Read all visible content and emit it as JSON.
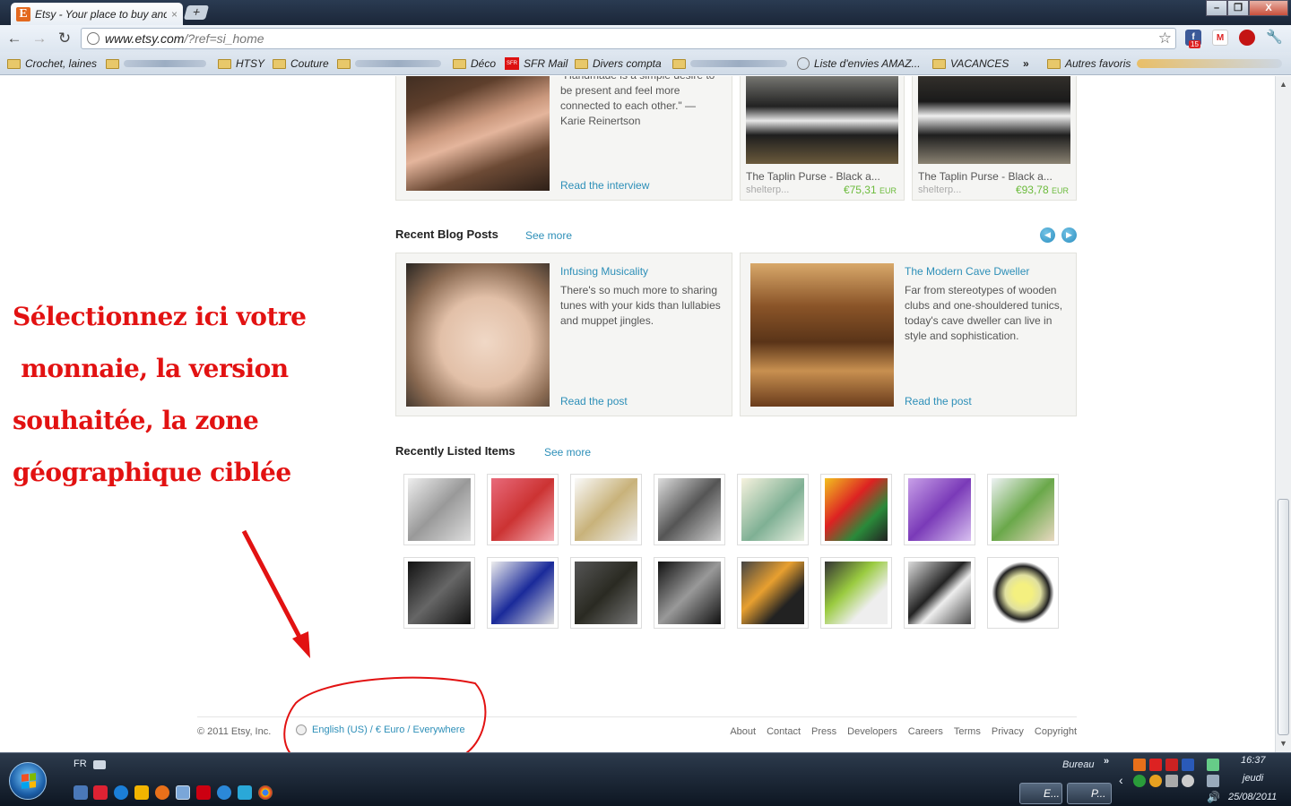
{
  "browser": {
    "tab_title": "Etsy - Your place to buy and",
    "tab_close": "×",
    "new_tab": "+",
    "url_host": "www.etsy.com",
    "url_rest": "/?ref=si_home",
    "ext_badge": "15",
    "bookmarks": [
      "Crochet, laines",
      "HTSY",
      "Couture",
      "Déco",
      "SFR Mail",
      "Divers compta",
      "Liste d'envies AMAZ...",
      "VACANCES",
      "Autres favoris"
    ],
    "bookmarks_more": "»",
    "window_controls": {
      "minimize": "–",
      "maximize": "❐",
      "close": "X"
    }
  },
  "featured": {
    "quote": "\"Handmade is a simple desire to be present and feel more connected to each other.\" — Karie Reinertson",
    "read_link": "Read the interview",
    "products": [
      {
        "title": "The Taplin Purse - Black a...",
        "shop": "shelterp...",
        "price": "€75,31",
        "currency": "EUR"
      },
      {
        "title": "The Taplin Purse - Black a...",
        "shop": "shelterp...",
        "price": "€93,78",
        "currency": "EUR"
      }
    ]
  },
  "blog": {
    "title": "Recent Blog Posts",
    "see_more": "See more",
    "posts": [
      {
        "title": "Infusing Musicality",
        "excerpt": "There's so much more to sharing tunes with your kids than lullabies and muppet jingles.",
        "link": "Read the post"
      },
      {
        "title": "The Modern Cave Dweller",
        "excerpt": "Far from stereotypes of wooden clubs and one-shouldered tunics, today's cave dweller can live in style and sophistication.",
        "link": "Read the post"
      }
    ]
  },
  "recent": {
    "title": "Recently Listed Items",
    "see_more": "See more",
    "items_count_row": 8
  },
  "footer": {
    "copyright": "© 2011 Etsy, Inc.",
    "locale": "English (US) / € Euro / Everywhere",
    "links": [
      "About",
      "Contact",
      "Press",
      "Developers",
      "Careers",
      "Terms",
      "Privacy",
      "Copyright"
    ]
  },
  "annotation": {
    "text": "Sélectionnez ici votre\n monnaie, la version\nsouhaitée, la zone\ngéographique ciblée",
    "color": "#e21212"
  },
  "taskbar": {
    "lang": "FR",
    "desktop_label": "Bureau",
    "desktop_more": "»",
    "tasks": [
      "E...",
      "P..."
    ],
    "time": "16:37",
    "day": "jeudi",
    "date": "25/08/2011",
    "tray_chevron": "‹"
  }
}
